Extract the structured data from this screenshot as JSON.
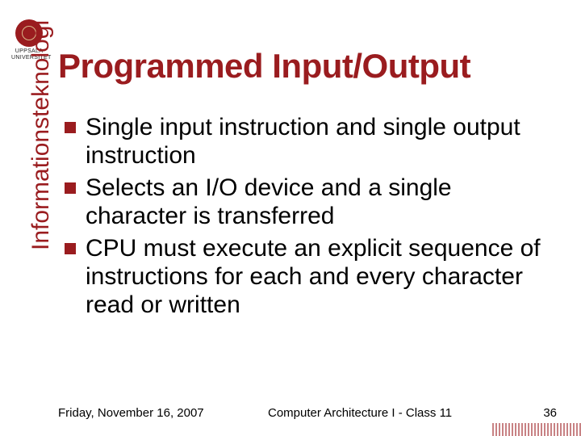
{
  "logo": {
    "line1": "UPPSALA",
    "line2": "UNIVERSITET"
  },
  "title": "Programmed Input/Output",
  "sidebar": "Informationsteknologi",
  "bullets": [
    "Single input instruction and single output instruction",
    "Selects an I/O device and a single character is transferred",
    "CPU must execute an explicit sequence of instructions for each and every character read or written"
  ],
  "footer": {
    "date": "Friday, November 16, 2007",
    "course": "Computer Architecture I - Class 11",
    "page": "36"
  }
}
